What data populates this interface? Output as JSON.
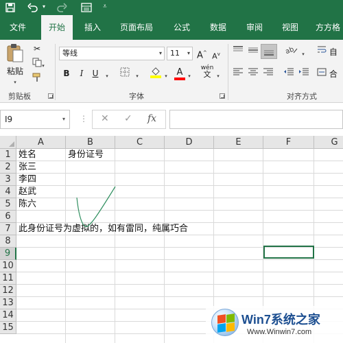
{
  "tabs": {
    "file": "文件",
    "home": "开始",
    "insert": "插入",
    "page_layout": "页面布局",
    "formulas": "公式",
    "data": "数据",
    "review": "审阅",
    "view": "视图",
    "more": "方方格"
  },
  "ribbon": {
    "clipboard": {
      "paste_label": "粘贴",
      "group_label": "剪贴板"
    },
    "font": {
      "font_name": "等线",
      "font_size": "11",
      "grow": "A",
      "shrink": "A",
      "bold": "B",
      "italic": "I",
      "underline": "U",
      "font_color": "A",
      "wen": "wén",
      "group_label": "字体"
    },
    "alignment": {
      "group_label": "对齐方式",
      "wrap_label": "自",
      "merge_label": "合"
    }
  },
  "formula_bar": {
    "name_box": "I9",
    "fx": "fx",
    "value": ""
  },
  "grid": {
    "columns": [
      "A",
      "B",
      "C",
      "D",
      "E",
      "F",
      "G"
    ],
    "rows": [
      "1",
      "2",
      "3",
      "4",
      "5",
      "6",
      "7",
      "8",
      "9",
      "10",
      "11",
      "12",
      "13",
      "14",
      "15"
    ],
    "selected_row": "9",
    "cells": {
      "A1": "姓名",
      "B1": "身份证号",
      "A2": "张三",
      "A3": "李四",
      "A4": "赵武",
      "A5": "陈六",
      "A7": "此身份证号为虚拟的，如有雷同，纯属巧合"
    }
  },
  "watermark": {
    "brand": "Win7系统之家",
    "url": "Www.Winwin7.com"
  },
  "colors": {
    "accent": "#217346",
    "ribbon_bg": "#f3f3f3",
    "highlight_yellow": "#ffff00",
    "font_red": "#ff0000"
  }
}
